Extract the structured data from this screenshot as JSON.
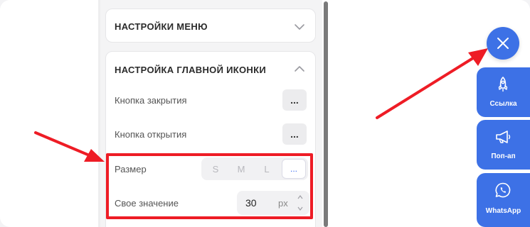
{
  "settings": {
    "menu_card": {
      "title": "НАСТРОЙКИ МЕНЮ"
    },
    "icon_card": {
      "title": "НАСТРОЙКА ГЛАВНОЙ ИКОНКИ",
      "close_button_label": "Кнопка закрытия",
      "close_button_action": "...",
      "open_button_label": "Кнопка открытия",
      "open_button_action": "...",
      "size_label": "Размер",
      "size_options": [
        "S",
        "M",
        "L",
        "..."
      ],
      "size_selected": "...",
      "custom_value_label": "Свое значение",
      "custom_value": "30",
      "custom_unit": "px"
    }
  },
  "widget": {
    "close_icon": "close-icon",
    "buttons": [
      {
        "label": "Ссылка",
        "icon": "rocket-icon"
      },
      {
        "label": "Поп-ап",
        "icon": "megaphone-icon"
      },
      {
        "label": "WhatsApp",
        "icon": "whatsapp-icon"
      }
    ]
  },
  "colors": {
    "accent": "#3d71e6",
    "annotation_red": "#ee1c25",
    "active_option": "#3d6cf0"
  }
}
